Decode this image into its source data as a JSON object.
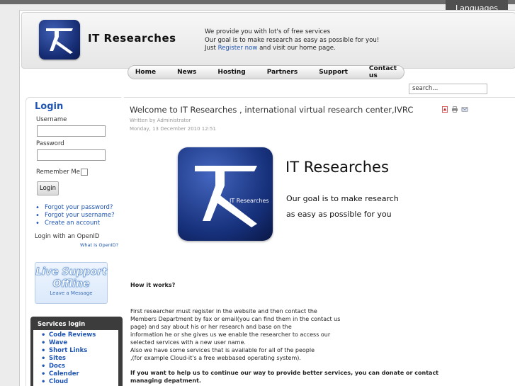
{
  "header": {
    "languages_label": "Languages",
    "site_title": "IT Researches",
    "tagline": {
      "line1": "We provide you with lot's of free services",
      "line2": "Our goal is to make research as easy as possible for you!",
      "line3_pre": "Just ",
      "line3_link": "Register now",
      "line3_post": " and visit our home page."
    }
  },
  "nav": {
    "items": [
      "Home",
      "News",
      "Hosting",
      "Partners",
      "Support",
      "Contact us"
    ]
  },
  "search": {
    "value": "search..."
  },
  "login": {
    "title": "Login",
    "username_label": "Username",
    "password_label": "Password",
    "remember_label": "Remember Me",
    "button_label": "Login",
    "links": [
      "Forgot your password?",
      "Forgot your username?",
      "Create an account"
    ],
    "openid_label": "Login with an OpenID",
    "whatis_label": "What is OpenID?"
  },
  "live_support": {
    "line1": "Live Support",
    "line2": "Offline",
    "line3": "Leave a Message"
  },
  "services": {
    "title": "Services login",
    "items": [
      "Code Reviews",
      "Wave",
      "Short Links",
      "Sites",
      "Docs",
      "Calender",
      "Cloud"
    ]
  },
  "article": {
    "title": "Welcome to IT Researches , international virtual research center,IVRC",
    "author": "Written by Administrator",
    "date": "Monday, 13 December 2010 12:51",
    "banner_logo_text": "IT Researches",
    "banner_title": "IT Researches",
    "banner_goal_line1": "Our goal is to make research",
    "banner_goal_line2": "as easy as possible for you",
    "how_heading": "How it works?",
    "paragraph_lines": [
      "First researcher must register in the website and then contact the",
      "Members Department by fax or email(you can find them in the contact us",
      "page) and say about his or her research and  base on the",
      "information he or she gives us we enable the researcher to access our",
      "selected services with a new user name.",
      "Also we have some services that is available for all of the people",
      ",(for example Cloud-it's a free webbased operating system)."
    ],
    "bold_paragraph": "If you want to help us to continue our way to provide better services, you can donate or contact managing depatment."
  },
  "colors": {
    "link": "#1f55b3",
    "logo_blue": "#16307a",
    "services_header": "#3c3c3c"
  }
}
